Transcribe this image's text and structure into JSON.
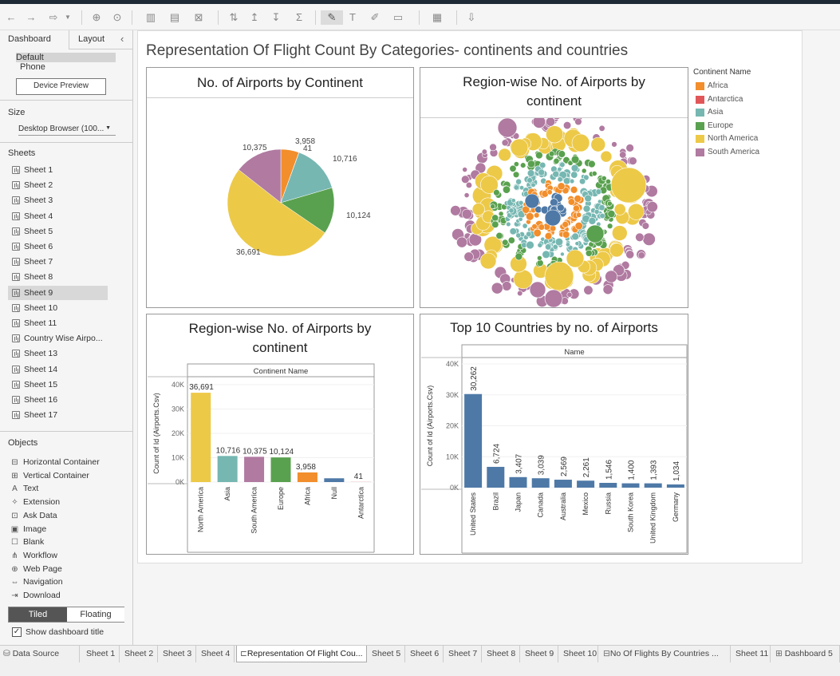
{
  "sidebar": {
    "tabs": [
      "Dashboard",
      "Layout"
    ],
    "device_options": [
      "Default",
      "Phone"
    ],
    "device_preview_label": "Device Preview",
    "size_header": "Size",
    "size_value": "Desktop Browser (100...",
    "sheets_header": "Sheets",
    "sheets": [
      "Sheet 1",
      "Sheet 2",
      "Sheet 3",
      "Sheet 4",
      "Sheet 5",
      "Sheet 6",
      "Sheet 7",
      "Sheet 8",
      "Sheet 9",
      "Sheet 10",
      "Sheet 11",
      "Country Wise Airpo...",
      "Sheet 13",
      "Sheet 14",
      "Sheet 15",
      "Sheet 16",
      "Sheet 17"
    ],
    "objects_header": "Objects",
    "objects": [
      {
        "label": "Horizontal Container",
        "icon": "horizontal-container-icon",
        "glyph": "⊟"
      },
      {
        "label": "Vertical Container",
        "icon": "vertical-container-icon",
        "glyph": "⊞"
      },
      {
        "label": "Text",
        "icon": "text-icon",
        "glyph": "A"
      },
      {
        "label": "Extension",
        "icon": "extension-icon",
        "glyph": "✧"
      },
      {
        "label": "Ask Data",
        "icon": "ask-data-icon",
        "glyph": "⊡"
      },
      {
        "label": "Image",
        "icon": "image-icon",
        "glyph": "▣"
      },
      {
        "label": "Blank",
        "icon": "blank-icon",
        "glyph": "☐"
      },
      {
        "label": "Workflow",
        "icon": "workflow-icon",
        "glyph": "⋔"
      },
      {
        "label": "Web Page",
        "icon": "web-page-icon",
        "glyph": "⊕"
      },
      {
        "label": "Navigation",
        "icon": "navigation-icon",
        "glyph": "⇔"
      },
      {
        "label": "Download",
        "icon": "download-icon",
        "glyph": "⇥"
      }
    ],
    "layout_toggle": [
      "Tiled",
      "Floating"
    ],
    "show_title_label": "Show dashboard title"
  },
  "bottom_tabs": [
    "Data Source",
    "Sheet 1",
    "Sheet 2",
    "Sheet 3",
    "Sheet 4",
    "Representation Of Flight Cou...",
    "Sheet 5",
    "Sheet 6",
    "Sheet 7",
    "Sheet 8",
    "Sheet 9",
    "Sheet 10",
    "No Of Flights By Countries ...",
    "Sheet 11",
    "Dashboard 5"
  ],
  "dashboard": {
    "title": "Representation Of Flight Count By Categories- continents and countries",
    "legend": {
      "title": "Continent Name",
      "items": [
        {
          "label": "Africa",
          "color": "#f28e2b"
        },
        {
          "label": "Antarctica",
          "color": "#e15759"
        },
        {
          "label": "Asia",
          "color": "#76b7b2"
        },
        {
          "label": "Europe",
          "color": "#59a14f"
        },
        {
          "label": "North America",
          "color": "#edc948"
        },
        {
          "label": "South America",
          "color": "#b07aa1"
        }
      ]
    },
    "pie_title": "No. of Airports by Continent",
    "bubble_title": "Region-wise No. of Airports by continent",
    "bar1_title": "Region-wise No. of Airports by continent",
    "bar1_header": "Continent Name",
    "bar1_ylabel": "Count of Id (Airports.Csv)",
    "bar2_title": "Top 10 Countries by no. of Airports",
    "bar2_header": "Name",
    "bar2_ylabel": "Count of Id (Airports.Csv)"
  },
  "chart_data": [
    {
      "type": "pie",
      "title": "No. of Airports by Continent",
      "categories": [
        "Africa",
        "Antarctica",
        "Asia",
        "Europe",
        "North America",
        "South America"
      ],
      "values": [
        3958,
        41,
        10716,
        10124,
        36691,
        10375
      ],
      "labels": [
        "3,958",
        "41",
        "10,716",
        "10,124",
        "36,691",
        "10,375"
      ]
    },
    {
      "type": "bar",
      "title": "Region-wise No. of Airports by continent",
      "categories": [
        "North America",
        "Asia",
        "South America",
        "Europe",
        "Africa",
        "Null",
        "Antarctica"
      ],
      "values": [
        36691,
        10716,
        10375,
        10124,
        3958,
        1550,
        41
      ],
      "labels": [
        "36,691",
        "10,716",
        "10,375",
        "10,124",
        "3,958",
        "",
        "41"
      ],
      "colors": [
        "#edc948",
        "#76b7b2",
        "#b07aa1",
        "#59a14f",
        "#f28e2b",
        "#4e79a7",
        "#e15759"
      ],
      "ylabel": "Count of Id (Airports.Csv)",
      "yticks": [
        "40K",
        "30K",
        "20K",
        "10K",
        "0K"
      ],
      "ylim": [
        0,
        40000
      ]
    },
    {
      "type": "bar",
      "title": "Top 10 Countries by no. of Airports",
      "categories": [
        "United States",
        "Brazil",
        "Japan",
        "Canada",
        "Australia",
        "Mexico",
        "Russia",
        "South Korea",
        "United Kingdom",
        "Germany"
      ],
      "values": [
        30262,
        6724,
        3407,
        3039,
        2569,
        2261,
        1546,
        1400,
        1393,
        1034
      ],
      "labels": [
        "30,262",
        "6,724",
        "3,407",
        "3,039",
        "2,569",
        "2,261",
        "1,546",
        "1,400",
        "1,393",
        "1,034"
      ],
      "ylabel": "Count of Id (Airports.Csv)",
      "yticks": [
        "40K",
        "30K",
        "20K",
        "10K",
        "0K"
      ],
      "ylim": [
        0,
        40000
      ]
    }
  ]
}
